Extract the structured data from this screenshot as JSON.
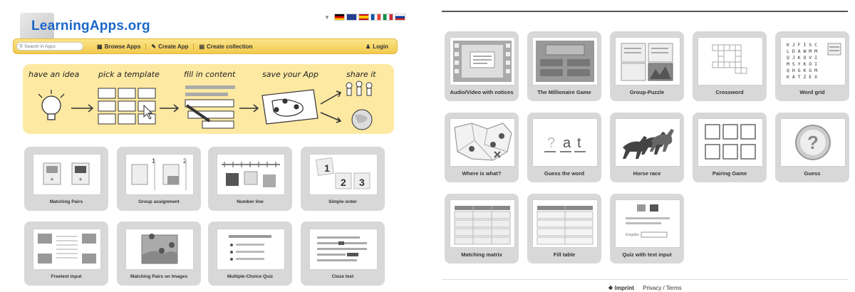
{
  "header": {
    "logo_text": "LearningApps.org",
    "flags": [
      "de",
      "en",
      "es",
      "fr",
      "it",
      "ru"
    ]
  },
  "nav": {
    "search_placeholder": "Search in Apps",
    "browse": "Browse Apps",
    "create": "Create App",
    "collection": "Create collection",
    "login": "Login"
  },
  "banner": {
    "steps": [
      "have an idea",
      "pick a template",
      "fill in content",
      "save your App",
      "share it"
    ]
  },
  "left_tiles": [
    "Matching Pairs",
    "Group assignment",
    "Number line",
    "Simple order",
    "Freetext input",
    "Matching Pairs on Images",
    "Multiple-Choice Quiz",
    "Cloze text"
  ],
  "right_tiles": [
    "Audio/Video with notices",
    "The Millionaire Game",
    "Group-Puzzle",
    "Crossword",
    "Word grid",
    "Where is what?",
    "Guess the word",
    "Horse race",
    "Pairing Game",
    "Guess",
    "Matching matrix",
    "Fill table",
    "Quiz with text input"
  ],
  "tile_text": {
    "simple_order": [
      "1",
      "2",
      "3"
    ],
    "group_assignment": [
      "1",
      "2"
    ],
    "guess_word": [
      "?",
      "a",
      "t"
    ],
    "quiz_text_input_label": "Eingabe:"
  },
  "word_grid": [
    "K J F I S C",
    "L D A W M M",
    "Q J K O V I",
    "M S Y K O I",
    "Q H G K G M",
    "K A T Z E X"
  ],
  "footer": {
    "imprint": "Imprint",
    "privacy": "Privacy / Terms"
  },
  "colors": {
    "logo_blue": "#1d67c9",
    "nav_yellow": "#f2c94c",
    "banner_yellow": "#fde9a2",
    "tile_gray": "#d8d8d8"
  }
}
